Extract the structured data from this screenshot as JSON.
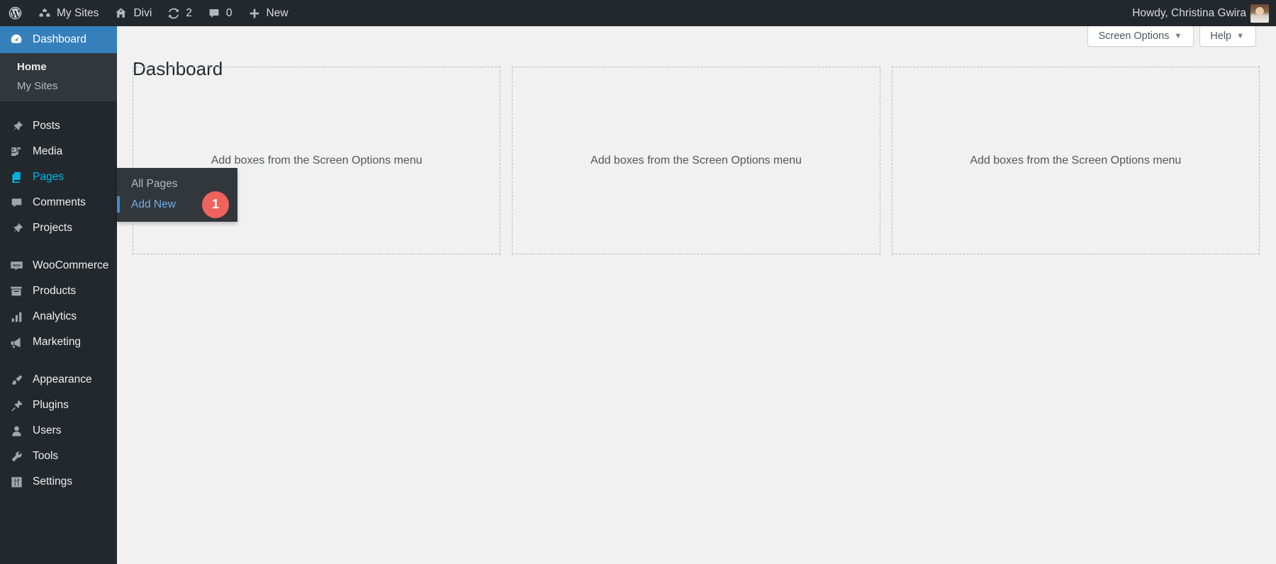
{
  "adminbar": {
    "left_items": [
      {
        "icon": "wordpress-logo-icon",
        "label": ""
      },
      {
        "icon": "my-sites-icon",
        "label": "My Sites"
      },
      {
        "icon": "home-icon",
        "label": "Divi"
      },
      {
        "icon": "updates-icon",
        "label": "2"
      },
      {
        "icon": "comment-bubble-icon",
        "label": "0"
      },
      {
        "icon": "plus-icon",
        "label": "New"
      }
    ],
    "howdy": "Howdy, Christina Gwira",
    "avatar_name": "avatar"
  },
  "sidebar": {
    "dashboard": {
      "label": "Dashboard",
      "icon": "dashboard-icon"
    },
    "dashboard_sub": [
      {
        "label": "Home",
        "active": true
      },
      {
        "label": "My Sites",
        "active": false
      }
    ],
    "items": [
      {
        "label": "Posts",
        "icon": "pin-icon"
      },
      {
        "label": "Media",
        "icon": "media-icon"
      },
      {
        "label": "Pages",
        "icon": "pages-icon"
      },
      {
        "label": "Comments",
        "icon": "comment-icon"
      },
      {
        "label": "Projects",
        "icon": "pin-icon"
      },
      {
        "label": "WooCommerce",
        "icon": "woocommerce-icon"
      },
      {
        "label": "Products",
        "icon": "products-icon"
      },
      {
        "label": "Analytics",
        "icon": "analytics-icon"
      },
      {
        "label": "Marketing",
        "icon": "megaphone-icon"
      },
      {
        "label": "Appearance",
        "icon": "paintbrush-icon"
      },
      {
        "label": "Plugins",
        "icon": "plug-icon"
      },
      {
        "label": "Users",
        "icon": "user-icon"
      },
      {
        "label": "Tools",
        "icon": "wrench-icon"
      },
      {
        "label": "Settings",
        "icon": "sliders-icon"
      }
    ]
  },
  "pages_flyout": {
    "items": [
      {
        "label": "All Pages",
        "active": false
      },
      {
        "label": "Add New",
        "active": true
      }
    ],
    "badge": "1",
    "badge_color": "#f0625c"
  },
  "screen_meta": {
    "screen_options": "Screen Options",
    "help": "Help",
    "caret": "▼"
  },
  "main": {
    "title": "Dashboard",
    "placeholder_text": "Add boxes from the Screen Options menu",
    "columns": 3
  },
  "colors": {
    "sidebar_bg": "#23282d",
    "submenu_bg": "#32373c",
    "accent_blue": "#3580bb",
    "link_blue": "#72aee6",
    "content_bg": "#f1f1f1",
    "badge_red": "#f0625c"
  }
}
